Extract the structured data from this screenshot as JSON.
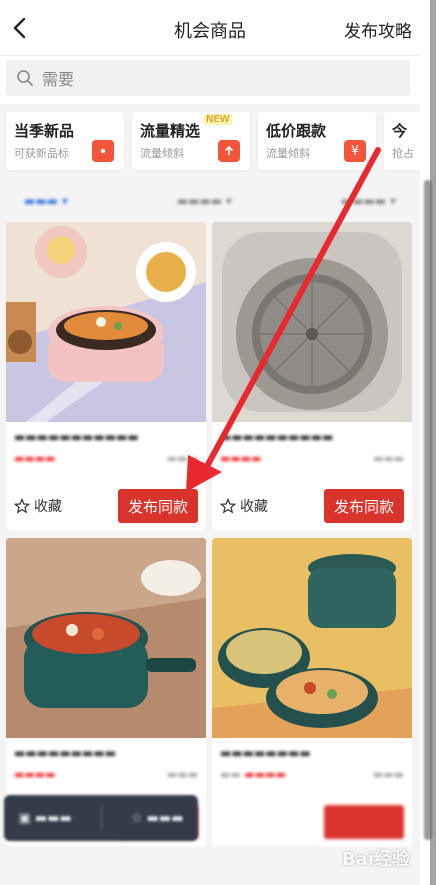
{
  "header": {
    "title": "机会商品",
    "right_action": "发布攻略"
  },
  "search": {
    "placeholder": "需要"
  },
  "categories": [
    {
      "name": "当季新品",
      "desc": "可获新品标",
      "icon": "tag-icon"
    },
    {
      "name": "流量精选",
      "desc": "流量倾斜",
      "badge": "NEW",
      "icon": "arrow-up-icon"
    },
    {
      "name": "低价跟款",
      "desc": "流量倾斜",
      "icon": "yen-icon"
    },
    {
      "name": "今",
      "desc": "抢占",
      "icon": ""
    }
  ],
  "products": [
    {
      "favorite_label": "收藏",
      "publish_label": "发布同款",
      "image": "pink-cooker-photo"
    },
    {
      "favorite_label": "收藏",
      "publish_label": "发布同款",
      "image": "steel-kettle-photo"
    },
    {
      "favorite_label": "",
      "publish_label": "",
      "image": "green-pot-photo"
    },
    {
      "favorite_label": "",
      "publish_label": "",
      "image": "teal-pot-photo"
    }
  ],
  "watermark": "Bai经验",
  "colors": {
    "accent": "#d9342b",
    "arrow": "#e8292f",
    "new_badge": "#e08a00"
  }
}
